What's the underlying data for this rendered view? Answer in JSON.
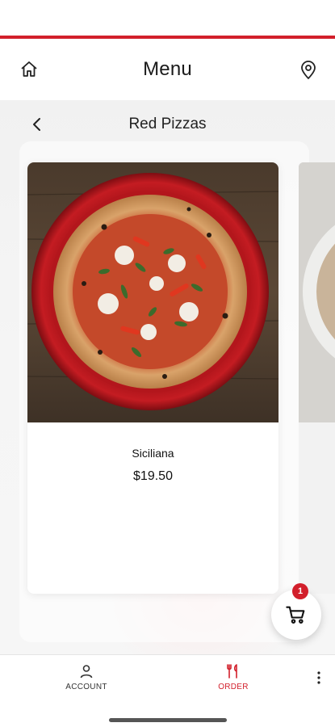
{
  "header": {
    "title": "Menu"
  },
  "category": {
    "title": "Red Pizzas"
  },
  "product": {
    "name": "Siciliana",
    "price": "$19.50"
  },
  "cart": {
    "count": "1"
  },
  "tabbar": {
    "items": [
      {
        "label": "ACCOUNT",
        "icon": "person-icon",
        "active": false
      },
      {
        "label": "ORDER",
        "icon": "fork-knife-icon",
        "active": true
      }
    ]
  },
  "colors": {
    "accent": "#d21f2b",
    "content_bg": "#f2f2f2"
  }
}
